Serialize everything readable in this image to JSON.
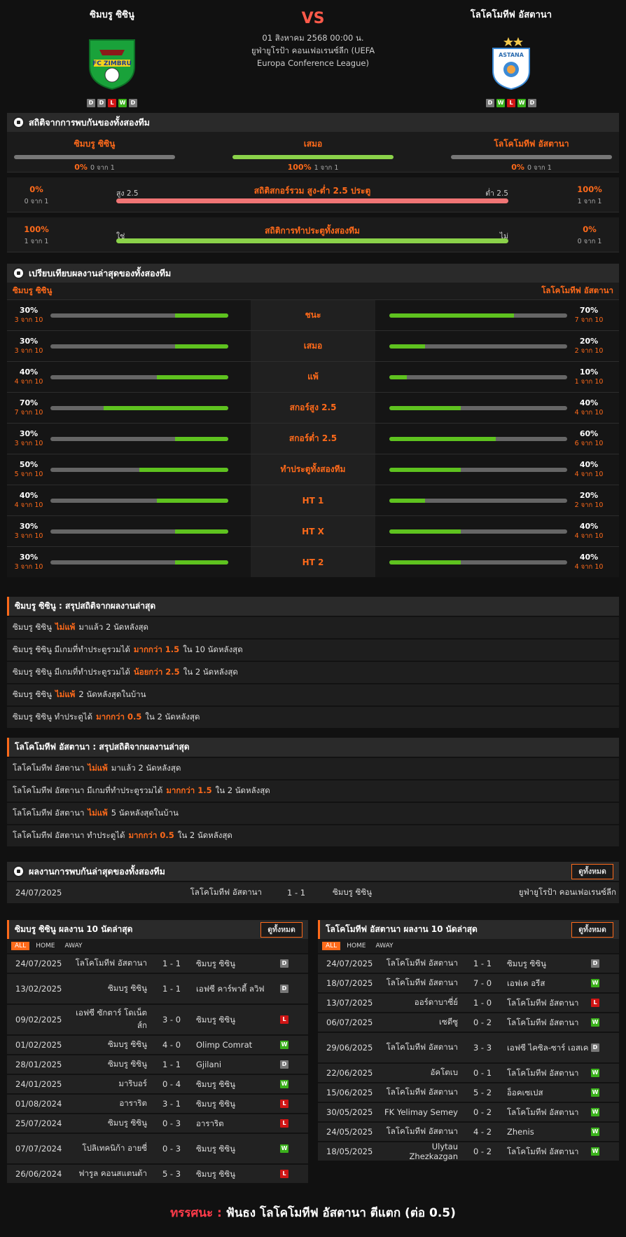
{
  "match": {
    "vs": "VS",
    "date": "01 สิงหาคม 2568 00:00 น.",
    "competition": "ยูฟ่ายูโรป้า คอนเฟอเรนซ์ลีก (UEFA Europa Conference League)",
    "home": {
      "name": "ซิมบรู ซิซินู",
      "form": [
        "D",
        "D",
        "L",
        "W",
        "D"
      ]
    },
    "away": {
      "name": "โลโคโมทีฟ อัสตานา",
      "form": [
        "D",
        "W",
        "L",
        "W",
        "D"
      ]
    }
  },
  "h2h_stats": {
    "title": "สถิติจากการพบกันของทั้งสองทีม",
    "cols": [
      {
        "label": "ซิมบรู ซิซินู",
        "pct": "0%",
        "count": "0 จาก 1",
        "color": "#777"
      },
      {
        "label": "เสมอ",
        "pct": "100%",
        "count": "1 จาก 1",
        "color": "#8bd24a"
      },
      {
        "label": "โลโคโมทีฟ อัสตานา",
        "pct": "0%",
        "count": "0 จาก 1",
        "color": "#777"
      }
    ],
    "ou": {
      "title": "สถิติสกอร์รวม สูง-ต่ำ 2.5 ประตู",
      "left_pct": "0%",
      "left_count": "0 จาก 1",
      "right_pct": "100%",
      "right_count": "1 จาก 1",
      "left_label": "สูง 2.5",
      "right_label": "ต่ำ 2.5"
    },
    "btts": {
      "title": "สถิติการทำประตูทั้งสองทีม",
      "left_pct": "100%",
      "left_count": "1 จาก 1",
      "right_pct": "0%",
      "right_count": "0 จาก 1",
      "left_label": "ใช่",
      "right_label": "ไม่"
    }
  },
  "compare": {
    "title": "เปรียบเทียบผลงานล่าสุดของทั้งสองทีม",
    "home": "ซิมบรู ซิซินู",
    "away": "โลโคโมทีฟ อัสตานา",
    "rows": [
      {
        "label": "ชนะ",
        "h": "30%",
        "hc": "3 จาก 10",
        "hv": 0.3,
        "a": "70%",
        "ac": "7 จาก 10",
        "av": 0.7
      },
      {
        "label": "เสมอ",
        "h": "30%",
        "hc": "3 จาก 10",
        "hv": 0.3,
        "a": "20%",
        "ac": "2 จาก 10",
        "av": 0.2
      },
      {
        "label": "แพ้",
        "h": "40%",
        "hc": "4 จาก 10",
        "hv": 0.4,
        "a": "10%",
        "ac": "1 จาก 10",
        "av": 0.1
      },
      {
        "label": "สกอร์สูง 2.5",
        "h": "70%",
        "hc": "7 จาก 10",
        "hv": 0.7,
        "a": "40%",
        "ac": "4 จาก 10",
        "av": 0.4
      },
      {
        "label": "สกอร์ต่ำ 2.5",
        "h": "30%",
        "hc": "3 จาก 10",
        "hv": 0.3,
        "a": "60%",
        "ac": "6 จาก 10",
        "av": 0.6
      },
      {
        "label": "ทำประตูทั้งสองทีม",
        "h": "50%",
        "hc": "5 จาก 10",
        "hv": 0.5,
        "a": "40%",
        "ac": "4 จาก 10",
        "av": 0.4
      },
      {
        "label": "HT 1",
        "h": "40%",
        "hc": "4 จาก 10",
        "hv": 0.4,
        "a": "20%",
        "ac": "2 จาก 10",
        "av": 0.2
      },
      {
        "label": "HT X",
        "h": "30%",
        "hc": "3 จาก 10",
        "hv": 0.3,
        "a": "40%",
        "ac": "4 จาก 10",
        "av": 0.4
      },
      {
        "label": "HT 2",
        "h": "30%",
        "hc": "3 จาก 10",
        "hv": 0.3,
        "a": "40%",
        "ac": "4 จาก 10",
        "av": 0.4
      }
    ]
  },
  "summary_home": {
    "title": "ซิมบรู ซิซินู : สรุปสถิติจากผลงานล่าสุด",
    "lines": [
      [
        "ซิมบรู ซิซินู",
        "ไม่แพ้",
        "มาแล้ว 2 นัดหลังสุด"
      ],
      [
        "ซิมบรู ซิซินู มีเกมที่ทำประตูรวมได้",
        "มากกว่า 1.5",
        "ใน 10 นัดหลังสุด"
      ],
      [
        "ซิมบรู ซิซินู มีเกมที่ทำประตูรวมได้",
        "น้อยกว่า 2.5",
        "ใน 2 นัดหลังสุด"
      ],
      [
        "ซิมบรู ซิซินู",
        "ไม่แพ้",
        "2 นัดหลังสุดในบ้าน"
      ],
      [
        "ซิมบรู ซิซินู ทำประตูได้",
        "มากกว่า 0.5",
        "ใน 2 นัดหลังสุด"
      ]
    ]
  },
  "summary_away": {
    "title": "โลโคโมทีฟ อัสตานา : สรุปสถิติจากผลงานล่าสุด",
    "lines": [
      [
        "โลโคโมทีฟ อัสตานา",
        "ไม่แพ้",
        "มาแล้ว 2 นัดหลังสุด"
      ],
      [
        "โลโคโมทีฟ อัสตานา มีเกมที่ทำประตูรวมได้",
        "มากกว่า 1.5",
        "ใน 2 นัดหลังสุด"
      ],
      [
        "โลโคโมทีฟ อัสตานา",
        "ไม่แพ้",
        "5 นัดหลังสุดในบ้าน"
      ],
      [
        "โลโคโมทีฟ อัสตานา ทำประตูได้",
        "มากกว่า 0.5",
        "ใน 2 นัดหลังสุด"
      ]
    ]
  },
  "h2h_results": {
    "title": "ผลงานการพบกันล่าสุดของทั้งสองทีม",
    "view_all": "ดูทั้งหมด",
    "rows": [
      {
        "date": "24/07/2025",
        "home": "โลโคโมทีฟ อัสตานา",
        "score": "1 - 1",
        "away": "ซิมบรู ซิซินู",
        "league": "ยูฟ่ายูโรป้า คอนเฟอเรนซ์ลีก"
      }
    ]
  },
  "last10_home": {
    "title": "ซิมบรู ซิซินู ผลงาน 10 นัดล่าสุด",
    "view_all": "ดูทั้งหมด",
    "tabs": [
      "ALL",
      "HOME",
      "AWAY"
    ],
    "rows": [
      {
        "date": "24/07/2025",
        "home": "โลโคโมทีฟ อัสตานา",
        "score": "1 - 1",
        "away": "ซิมบรู ซิซินู",
        "r": "D"
      },
      {
        "date": "13/02/2025",
        "home": "ซิมบรู ซิซินู",
        "score": "1 - 1",
        "away": "เอฟซี คาร์พาตี้ ลวิฟ",
        "r": "D"
      },
      {
        "date": "09/02/2025",
        "home": "เอฟซี ซักตาร์ โดเน็ตส์ก",
        "score": "3 - 0",
        "away": "ซิมบรู ซิซินู",
        "r": "L"
      },
      {
        "date": "01/02/2025",
        "home": "ซิมบรู ซิซินู",
        "score": "4 - 0",
        "away": "Olimp Comrat",
        "r": "W"
      },
      {
        "date": "28/01/2025",
        "home": "ซิมบรู ซิซินู",
        "score": "1 - 1",
        "away": "Gjilani",
        "r": "D"
      },
      {
        "date": "24/01/2025",
        "home": "มาริบอร์",
        "score": "0 - 4",
        "away": "ซิมบรู ซิซินู",
        "r": "W"
      },
      {
        "date": "01/08/2024",
        "home": "อาราริต",
        "score": "3 - 1",
        "away": "ซิมบรู ซิซินู",
        "r": "L"
      },
      {
        "date": "25/07/2024",
        "home": "ซิมบรู ซิซินู",
        "score": "0 - 3",
        "away": "อาราริต",
        "r": "L"
      },
      {
        "date": "07/07/2024",
        "home": "โปลิเทคนิก้า อายซี่",
        "score": "0 - 3",
        "away": "ซิมบรู ซิซินู",
        "r": "W"
      },
      {
        "date": "26/06/2024",
        "home": "ฟารูล คอนสแตนต้า",
        "score": "5 - 3",
        "away": "ซิมบรู ซิซินู",
        "r": "L"
      }
    ]
  },
  "last10_away": {
    "title": "โลโคโมทีฟ อัสตานา ผลงาน 10 นัดล่าสุด",
    "view_all": "ดูทั้งหมด",
    "tabs": [
      "ALL",
      "HOME",
      "AWAY"
    ],
    "rows": [
      {
        "date": "24/07/2025",
        "home": "โลโคโมทีฟ อัสตานา",
        "score": "1 - 1",
        "away": "ซิมบรู ซิซินู",
        "r": "D"
      },
      {
        "date": "18/07/2025",
        "home": "โลโคโมทีฟ อัสตานา",
        "score": "7 - 0",
        "away": "เอฟเค อรีส",
        "r": "W"
      },
      {
        "date": "13/07/2025",
        "home": "ออร์ดาบาซี่ย์",
        "score": "1 - 0",
        "away": "โลโคโมทีฟ อัสตานา",
        "r": "L"
      },
      {
        "date": "06/07/2025",
        "home": "เซตีซู",
        "score": "0 - 2",
        "away": "โลโคโมทีฟ อัสตานา",
        "r": "W"
      },
      {
        "date": "29/06/2025",
        "home": "โลโคโมทีฟ อัสตานา",
        "score": "3 - 3",
        "away": "เอฟซี ไคซิล-ซาร์ เอสเค",
        "r": "D"
      },
      {
        "date": "22/06/2025",
        "home": "อัคโตเบ",
        "score": "0 - 1",
        "away": "โลโคโมทีฟ อัสตานา",
        "r": "W"
      },
      {
        "date": "15/06/2025",
        "home": "โลโคโมทีฟ อัสตานา",
        "score": "5 - 2",
        "away": "อ็อคเซเปส",
        "r": "W"
      },
      {
        "date": "30/05/2025",
        "home": "FK Yelimay Semey",
        "score": "0 - 2",
        "away": "โลโคโมทีฟ อัสตานา",
        "r": "W"
      },
      {
        "date": "24/05/2025",
        "home": "โลโคโมทีฟ อัสตานา",
        "score": "4 - 2",
        "away": "Zhenis",
        "r": "W"
      },
      {
        "date": "18/05/2025",
        "home": "Ulytau Zhezkazgan",
        "score": "0 - 2",
        "away": "โลโคโมทีฟ อัสตานา",
        "r": "W"
      }
    ]
  },
  "prediction": {
    "label": "ทรรศนะ :",
    "text": "ฟันธง โลโคโมทีฟ อัสตานา ตีแตก (ต่อ 0.5)"
  }
}
